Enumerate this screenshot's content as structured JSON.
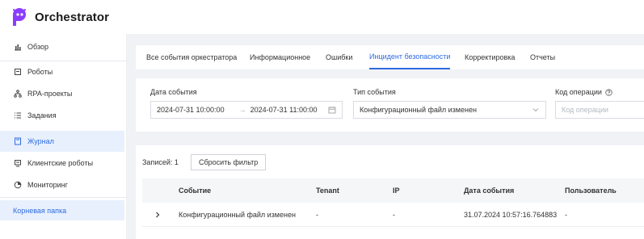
{
  "app": {
    "title": "Orchestrator",
    "brand_color": "#8b3dff"
  },
  "sidebar": {
    "items": [
      {
        "label": "Обзор",
        "icon": "bar-chart-icon"
      },
      {
        "label": "Роботы",
        "icon": "robot-icon"
      },
      {
        "label": "RPA-проекты",
        "icon": "project-tree-icon"
      },
      {
        "label": "Задания",
        "icon": "list-icon"
      },
      {
        "label": "Журнал",
        "icon": "journal-icon",
        "active": true
      },
      {
        "label": "Клиентские роботы",
        "icon": "client-robot-icon"
      },
      {
        "label": "Мониторинг",
        "icon": "monitoring-icon"
      }
    ],
    "folder": {
      "label": "Корневая папка",
      "active": true
    }
  },
  "tabs": [
    {
      "label": "Все события оркестратора"
    },
    {
      "label": "Информационное"
    },
    {
      "label": "Ошибки"
    },
    {
      "label": "Инцидент безопасности",
      "active": true
    },
    {
      "label": "Корректировка"
    },
    {
      "label": "Отчеты"
    }
  ],
  "filters": {
    "date": {
      "label": "Дата события",
      "from": "2024-07-31 10:00:00",
      "to": "2024-07-31 11:00:00",
      "arrow": "→"
    },
    "type": {
      "label": "Тип события",
      "value": "Конфигурационный файл изменен"
    },
    "opcode": {
      "label": "Код операции",
      "placeholder": "Код операции"
    }
  },
  "table": {
    "records_label": "Записей: 1",
    "reset_label": "Сбросить фильтр",
    "columns": [
      "Событие",
      "Tenant",
      "IP",
      "Дата события",
      "Пользователь"
    ],
    "rows": [
      {
        "expander": "›",
        "event": "Конфигурационный файл изменен",
        "tenant": "-",
        "ip": "-",
        "date": "31.07.2024 10:57:16.764883",
        "user": "-"
      }
    ]
  },
  "accent_color": "#2d6cdf"
}
